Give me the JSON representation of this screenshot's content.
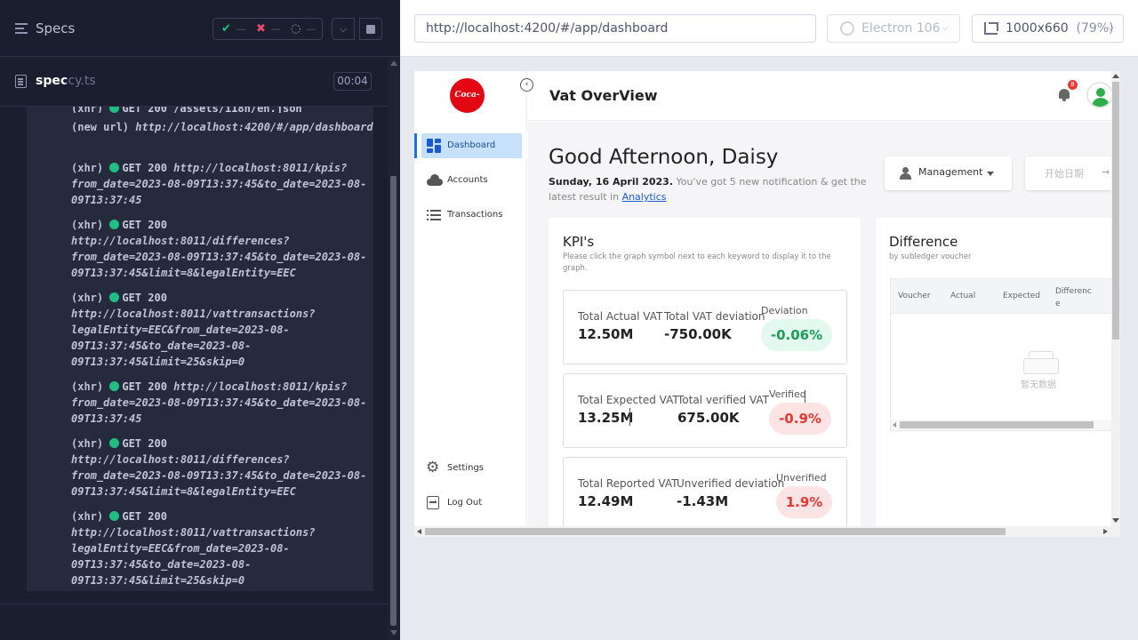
{
  "runner": {
    "specs_label": "Specs",
    "stats": {
      "passed": "—",
      "failed": "—",
      "pending": "—"
    },
    "spec_file": {
      "name": "spec",
      "ext": ".cy.ts",
      "timer": "00:04"
    },
    "log": [
      {
        "type": "(new url)",
        "text": "http://localhost:4200/#/app/dashboard"
      },
      {
        "type": "(xhr)",
        "status": "GET 200",
        "text": "http://localhost:8011/kpis?from_date=2023-08-09T13:37:45&to_date=2023-08-09T13:37:45"
      },
      {
        "type": "(xhr)",
        "status": "GET 200",
        "text": "http://localhost:8011/differences?from_date=2023-08-09T13:37:45&to_date=2023-08-09T13:37:45&limit=8&legalEntity=EEC"
      },
      {
        "type": "(xhr)",
        "status": "GET 200",
        "text": "http://localhost:8011/vattransactions?legalEntity=EEC&from_date=2023-08-09T13:37:45&to_date=2023-08-09T13:37:45&limit=25&skip=0"
      },
      {
        "type": "(xhr)",
        "status": "GET 200",
        "text": "http://localhost:8011/kpis?from_date=2023-08-09T13:37:45&to_date=2023-08-09T13:37:45"
      },
      {
        "type": "(xhr)",
        "status": "GET 200",
        "text": "http://localhost:8011/differences?from_date=2023-08-09T13:37:45&to_date=2023-08-09T13:37:45&limit=8&legalEntity=EEC"
      },
      {
        "type": "(xhr)",
        "status": "GET 200",
        "text": "http://localhost:8011/vattransactions?legalEntity=EEC&from_date=2023-08-09T13:37:45&to_date=2023-08-09T13:37:45&limit=25&skip=0"
      }
    ]
  },
  "browser": {
    "url": "http://localhost:4200/#/app/dashboard",
    "engine": "Electron 106",
    "viewport": "1000x660",
    "zoom": "(79%)"
  },
  "app": {
    "logo_text": "Coca-Cola",
    "page_title": "Vat OverView",
    "notification_count": "8",
    "nav": [
      {
        "label": "Dashboard",
        "active": true
      },
      {
        "label": "Accounts"
      },
      {
        "label": "Transactions"
      },
      {
        "label": "Settings"
      },
      {
        "label": "Log Out"
      }
    ],
    "greeting": "Good Afternoon, Daisy",
    "date": "Sunday, 16 April 2023.",
    "notice": "You've got 5 new notification & get the latest result in",
    "notice_link": "Analytics",
    "role_select": "Management",
    "date_placeholder": "开始日期",
    "date_arrow": "→",
    "kpi": {
      "title": "KPI's",
      "subtitle": "Please click the graph symbol next to each keyword to display it to the graph.",
      "rows": [
        {
          "label_a": "Total Actual VAT",
          "value_a": "12.50M",
          "label_b": "Total VAT deviation",
          "value_b": "-750.00K",
          "pill_label": "Deviation",
          "pill_value": "-0.06%",
          "pill_color": "#1a9e5a"
        },
        {
          "label_a": "Total Expected VAT",
          "value_a": "13.25M",
          "label_b": "Total verified VAT",
          "value_b": "675.00K",
          "pill_label": "Verified",
          "pill_value": "-0.9%",
          "pill_color": "#e53935"
        },
        {
          "label_a": "Total Reported VAT",
          "value_a": "12.49M",
          "label_b": "Unverified deviation",
          "value_b": "-1.43M",
          "pill_label": "Unverified",
          "pill_value": "1.9%",
          "pill_color": "#e53935"
        }
      ]
    },
    "difference": {
      "title": "Difference",
      "subtitle": "by subledger voucher",
      "columns": [
        "Voucher",
        "Actual",
        "Expected",
        "Difference"
      ],
      "empty_text": "暂无数据"
    }
  },
  "colors": {
    "accent": "#1a73e8",
    "pass": "#1fbe85",
    "fail": "#e9486f",
    "brand": "#e30613"
  }
}
